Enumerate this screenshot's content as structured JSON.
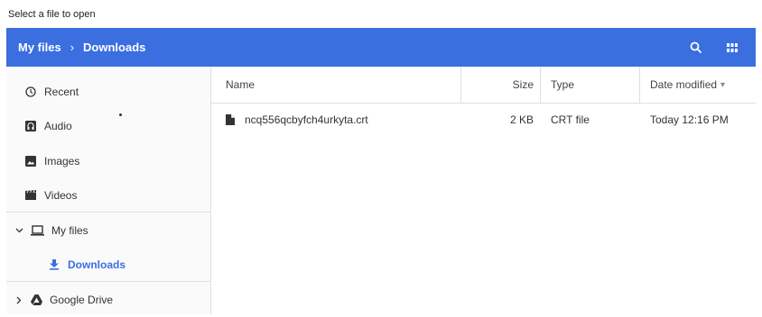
{
  "dialog": {
    "title": "Select a file to open"
  },
  "breadcrumb": {
    "items": [
      "My files",
      "Downloads"
    ],
    "separator": "›"
  },
  "toolbar": {
    "search_icon": "search-icon",
    "view_icon": "grid-view-icon"
  },
  "sidebar": {
    "recent": "Recent",
    "audio": "Audio",
    "images": "Images",
    "videos": "Videos",
    "my_files": "My files",
    "downloads": "Downloads",
    "google_drive": "Google Drive"
  },
  "columns": {
    "name": "Name",
    "size": "Size",
    "type": "Type",
    "date": "Date modified",
    "sort_indicator": "▾"
  },
  "files": [
    {
      "name": "ncq556qcbyfch4urkyta.crt",
      "size": "2 KB",
      "type": "CRT file",
      "date": "Today 12:16 PM"
    }
  ],
  "colors": {
    "accent": "#3b6fe0",
    "sidebar_bg": "#fafafa",
    "divider": "#e0e0e0"
  }
}
